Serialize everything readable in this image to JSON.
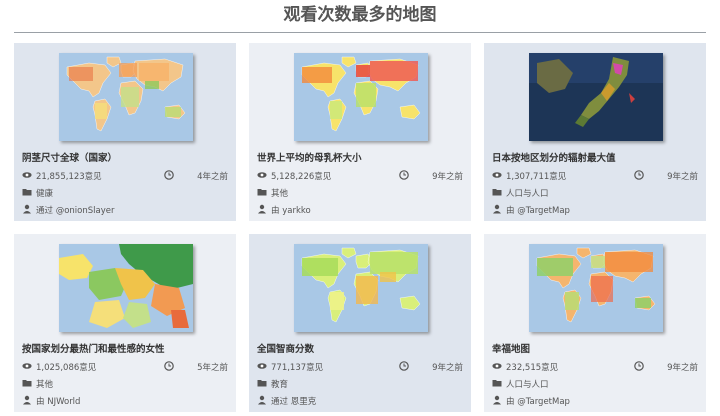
{
  "page": {
    "title": "观看次数最多的地图"
  },
  "cards": [
    {
      "title": "阴茎尺寸全球（国家）",
      "views": "21,855,123意见",
      "time": "4年之前",
      "category": "健康",
      "author_prefix": "通过",
      "author": "@onionSlayer",
      "map_theme": "world-orange-green"
    },
    {
      "title": "世界上平均的母乳杯大小",
      "views": "5,128,226意见",
      "time": "9年之前",
      "category": "其他",
      "author_prefix": "由",
      "author": "yarkko",
      "map_theme": "world-red-yellow"
    },
    {
      "title": "日本按地区划分的辐射最大值",
      "views": "1,307,711意见",
      "time": "9年之前",
      "category": "人口与人口",
      "author_prefix": "由",
      "author": "@TargetMap",
      "map_theme": "japan-satellite"
    },
    {
      "title": "按国家划分最热门和最性感的女性",
      "views": "1,025,086意见",
      "time": "5年之前",
      "category": "其他",
      "author_prefix": "由",
      "author": "NJWorld",
      "map_theme": "europe-green"
    },
    {
      "title": "全国智商分数",
      "views": "771,137意见",
      "time": "9年之前",
      "category": "教育",
      "author_prefix": "通过",
      "author": "恩里克",
      "map_theme": "world-green"
    },
    {
      "title": "幸福地图",
      "views": "232,515意见",
      "time": "9年之前",
      "category": "人口与人口",
      "author_prefix": "由",
      "author": "@TargetMap",
      "map_theme": "world-orange"
    }
  ],
  "icons": {
    "views": "eye-icon",
    "time": "clock-icon",
    "category": "folder-icon",
    "author": "user-icon"
  },
  "colors": {
    "card_bg": "#dfe5ee",
    "card_bg_alt": "#eceff4",
    "ocean": "#a9c8e6",
    "title_rule": "#9aa0a6"
  }
}
